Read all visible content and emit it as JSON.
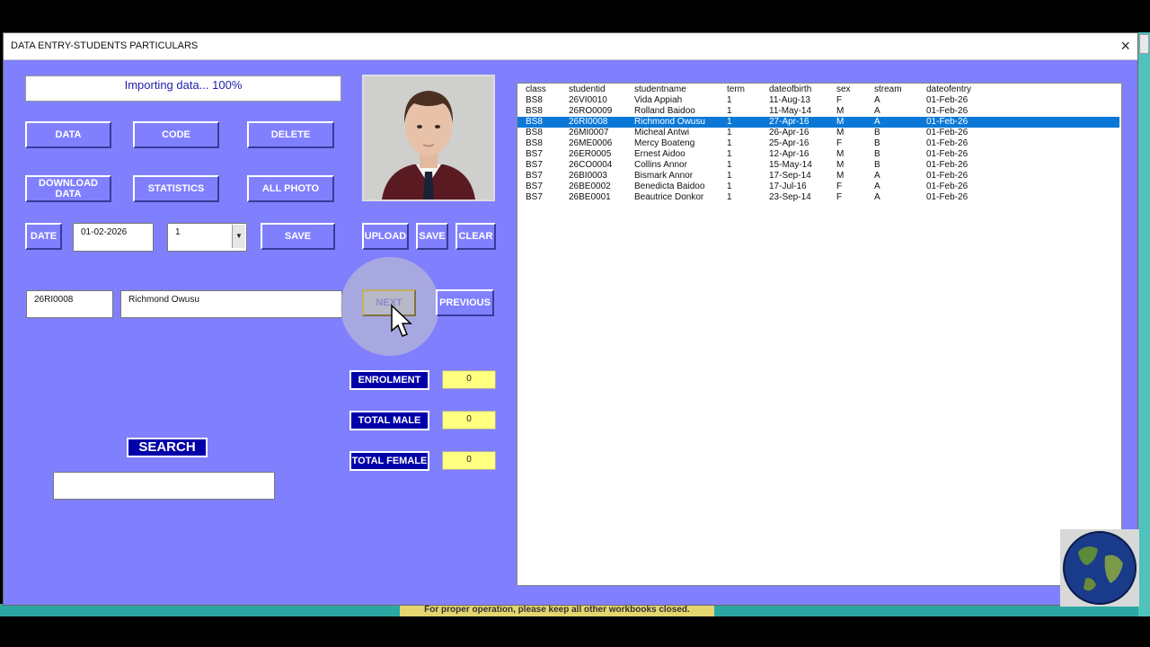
{
  "window": {
    "title": "DATA ENTRY-STUDENTS PARTICULARS",
    "close_icon": "×"
  },
  "progress_text": "Importing data... 100%",
  "buttons": {
    "data": "DATA",
    "code": "CODE",
    "delete": "DELETE",
    "download_data": "DOWNLOAD DATA",
    "statistics": "STATISTICS",
    "all_photo": "ALL PHOTO",
    "date": "DATE",
    "save": "SAVE",
    "upload": "UPLOAD",
    "photo_save": "SAVE",
    "clear": "CLEAR",
    "next": "NEXT",
    "previous": "PREVIOUS"
  },
  "date_value": "01-02-2026",
  "term_combo": {
    "value": "1",
    "arrow": "▼"
  },
  "student": {
    "id": "26RI0008",
    "name": "Richmond Owusu"
  },
  "stats": {
    "enrolment_label": "ENROLMENT",
    "enrolment_value": "0",
    "male_label": "TOTAL MALE",
    "male_value": "0",
    "female_label": "TOTAL FEMALE",
    "female_value": "0"
  },
  "search": {
    "label": "SEARCH",
    "value": ""
  },
  "status_note": "For proper operation, please keep all other workbooks closed.",
  "table": {
    "headers": [
      "class",
      "studentid",
      "studentname",
      "term",
      "dateofbirth",
      "sex",
      "stream",
      "dateofentry"
    ],
    "rows": [
      [
        "BS8",
        "26VI0010",
        "Vida Appiah",
        "1",
        "11-Aug-13",
        "F",
        "A",
        "01-Feb-26"
      ],
      [
        "BS8",
        "26RO0009",
        "Rolland Baidoo",
        "1",
        "11-May-14",
        "M",
        "A",
        "01-Feb-26"
      ],
      [
        "BS8",
        "26RI0008",
        "Richmond Owusu",
        "1",
        "27-Apr-16",
        "M",
        "A",
        "01-Feb-26"
      ],
      [
        "BS8",
        "26MI0007",
        "Micheal Antwi",
        "1",
        "26-Apr-16",
        "M",
        "B",
        "01-Feb-26"
      ],
      [
        "BS8",
        "26ME0006",
        "Mercy Boateng",
        "1",
        "25-Apr-16",
        "F",
        "B",
        "01-Feb-26"
      ],
      [
        "BS7",
        "26ER0005",
        "Ernest Aidoo",
        "1",
        "12-Apr-16",
        "M",
        "B",
        "01-Feb-26"
      ],
      [
        "BS7",
        "26CO0004",
        "Collins Annor",
        "1",
        "15-May-14",
        "M",
        "B",
        "01-Feb-26"
      ],
      [
        "BS7",
        "26BI0003",
        "Bismark Annor",
        "1",
        "17-Sep-14",
        "M",
        "A",
        "01-Feb-26"
      ],
      [
        "BS7",
        "26BE0002",
        "Benedicta Baidoo",
        "1",
        "17-Jul-16",
        "F",
        "A",
        "01-Feb-26"
      ],
      [
        "BS7",
        "26BE0001",
        "Beautrice Donkor",
        "1",
        "23-Sep-14",
        "F",
        "A",
        "01-Feb-26"
      ]
    ],
    "selected_row": 2
  },
  "colors": {
    "form_bg": "#8080ff",
    "label_bg": "#0000a8",
    "value_bg": "#ffff80",
    "selection": "#0b78d7"
  }
}
